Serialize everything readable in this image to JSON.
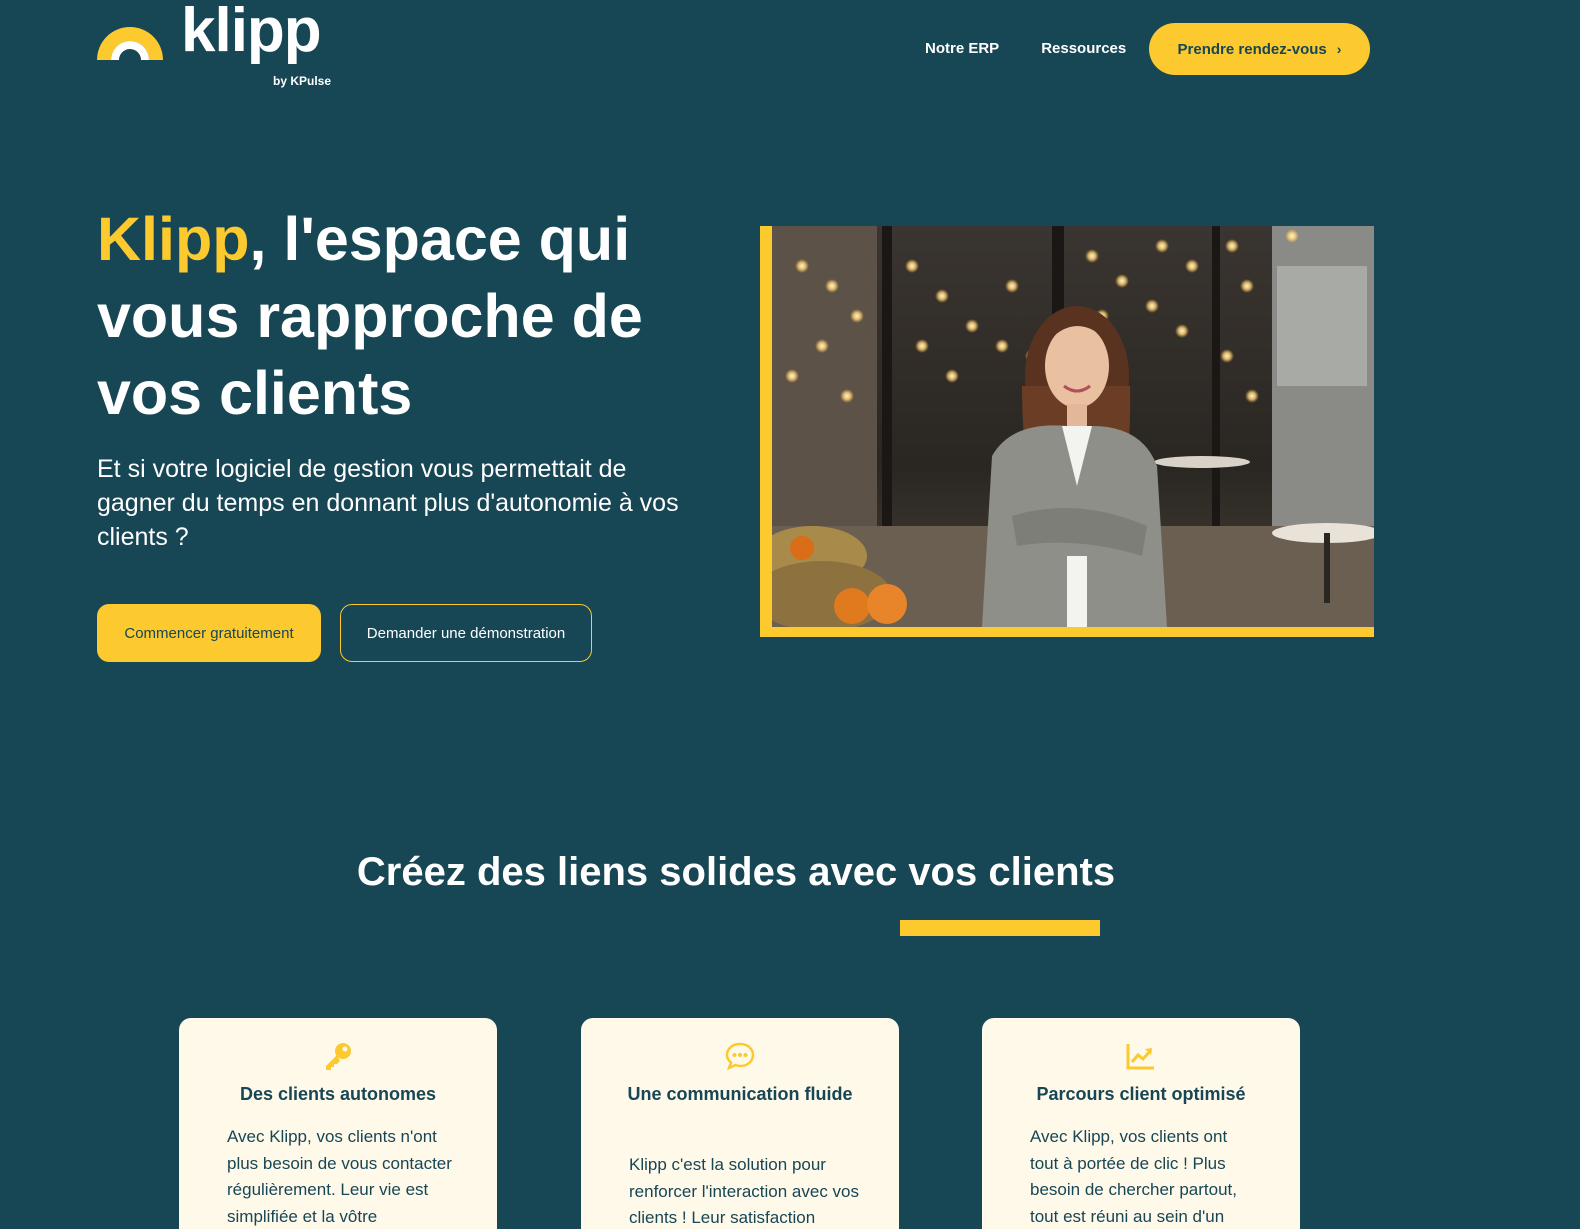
{
  "header": {
    "logo_word": "klipp",
    "logo_sub": "by KPulse",
    "nav": [
      {
        "label": "Notre ERP"
      },
      {
        "label": "Ressources"
      }
    ],
    "cta_label": "Prendre rendez-vous"
  },
  "hero": {
    "title_accent": "Klipp",
    "title_rest": ", l'espace qui vous rapproche de vos clients",
    "subtitle": "Et si votre logiciel de gestion vous permettait de gagner du temps en donnant plus d'autonomie à vos clients ?",
    "primary_button": "Commencer gratuitement",
    "secondary_button": "Demander une démonstration"
  },
  "section": {
    "title": "Créez des liens solides avec vos clients"
  },
  "cards": [
    {
      "icon": "key-icon",
      "title": "Des clients autonomes",
      "text": "Avec Klipp, vos clients n'ont plus besoin de vous contacter régulièrement. Leur vie est simplifiée et la vôtre"
    },
    {
      "icon": "chat-bubble-icon",
      "title": "Une communication fluide",
      "text": "Klipp c'est la solution pour renforcer l'interaction avec vos clients ! Leur satisfaction"
    },
    {
      "icon": "chart-line-icon",
      "title": "Parcours client optimisé",
      "text": "Avec Klipp, vos clients ont tout à portée de clic ! Plus besoin de chercher partout, tout est réuni au sein d'un"
    }
  ],
  "colors": {
    "background": "#174655",
    "accent": "#fcc92e",
    "card_background": "#fff9ea"
  }
}
